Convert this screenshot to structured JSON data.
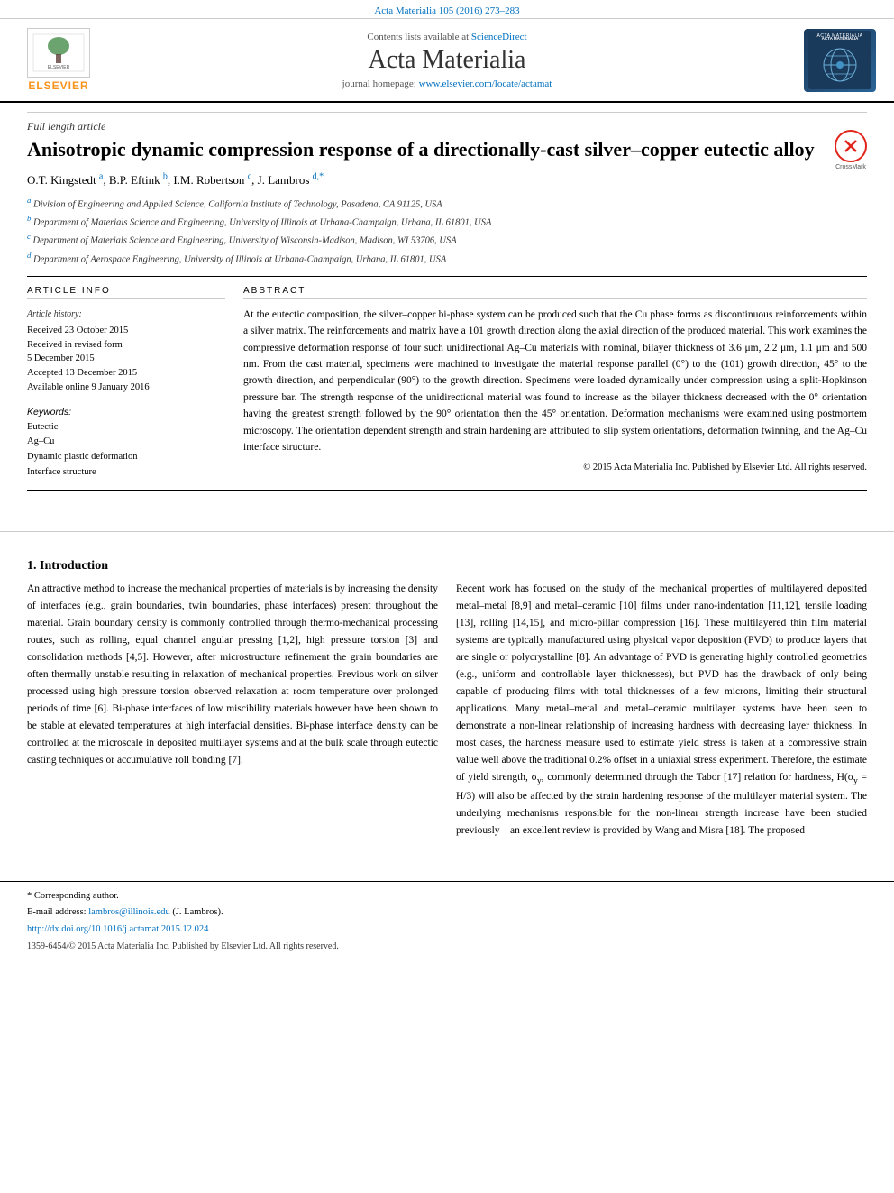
{
  "topbar": {
    "citation": "Acta Materialia 105 (2016) 273–283"
  },
  "header": {
    "contents_text": "Contents lists available at",
    "contents_link": "ScienceDirect",
    "journal_title": "Acta Materialia",
    "homepage_text": "journal homepage:",
    "homepage_url": "www.elsevier.com/locate/actamat",
    "elsevier_brand": "ELSEVIER"
  },
  "article": {
    "type": "Full length article",
    "title": "Anisotropic dynamic compression response of a directionally-cast silver–copper eutectic alloy",
    "authors": "O.T. Kingstedt a, B.P. Eftink b, I.M. Robertson c, J. Lambros d,*",
    "affiliations": [
      "a Division of Engineering and Applied Science, California Institute of Technology, Pasadena, CA 91125, USA",
      "b Department of Materials Science and Engineering, University of Illinois at Urbana-Champaign, Urbana, IL 61801, USA",
      "c Department of Materials Science and Engineering, University of Wisconsin-Madison, Madison, WI 53706, USA",
      "d Department of Aerospace Engineering, University of Illinois at Urbana-Champaign, Urbana, IL 61801, USA"
    ]
  },
  "article_info": {
    "section_label": "ARTICLE INFO",
    "history_label": "Article history:",
    "history_items": [
      "Received 23 October 2015",
      "Received in revised form",
      "5 December 2015",
      "Accepted 13 December 2015",
      "Available online 9 January 2016"
    ],
    "keywords_label": "Keywords:",
    "keywords": [
      "Eutectic",
      "Ag–Cu",
      "Dynamic plastic deformation",
      "Interface structure"
    ]
  },
  "abstract": {
    "section_label": "ABSTRACT",
    "text": "At the eutectic composition, the silver–copper bi-phase system can be produced such that the Cu phase forms as discontinuous reinforcements within a silver matrix. The reinforcements and matrix have a 101 growth direction along the axial direction of the produced material. This work examines the compressive deformation response of four such unidirectional Ag–Cu materials with nominal, bilayer thickness of 3.6 μm, 2.2 μm, 1.1 μm and 500 nm. From the cast material, specimens were machined to investigate the material response parallel (0°) to the (101) growth direction, 45° to the growth direction, and perpendicular (90°) to the growth direction. Specimens were loaded dynamically under compression using a split-Hopkinson pressure bar. The strength response of the unidirectional material was found to increase as the bilayer thickness decreased with the 0° orientation having the greatest strength followed by the 90° orientation then the 45° orientation. Deformation mechanisms were examined using postmortem microscopy. The orientation dependent strength and strain hardening are attributed to slip system orientations, deformation twinning, and the Ag–Cu interface structure.",
    "copyright": "© 2015 Acta Materialia Inc. Published by Elsevier Ltd. All rights reserved."
  },
  "introduction": {
    "section_number": "1.",
    "section_title": "Introduction",
    "left_col_paragraphs": [
      "An attractive method to increase the mechanical properties of materials is by increasing the density of interfaces (e.g., grain boundaries, twin boundaries, phase interfaces) present throughout the material. Grain boundary density is commonly controlled through thermo-mechanical processing routes, such as rolling, equal channel angular pressing [1,2], high pressure torsion [3] and consolidation methods [4,5]. However, after microstructure refinement the grain boundaries are often thermally unstable resulting in relaxation of mechanical properties. Previous work on silver processed using high pressure torsion observed relaxation at room temperature over prolonged periods of time [6]. Bi-phase interfaces of low miscibility materials however have been shown to be stable at elevated temperatures at high interfacial densities. Bi-phase interface density can be controlled at the microscale in deposited multilayer systems and at the bulk scale through eutectic casting techniques or accumulative roll bonding [7]."
    ],
    "right_col_paragraphs": [
      "Recent work has focused on the study of the mechanical properties of multilayered deposited metal–metal [8,9] and metal–ceramic [10] films under nano-indentation [11,12], tensile loading [13], rolling [14,15], and micro-pillar compression [16]. These multilayered thin film material systems are typically manufactured using physical vapor deposition (PVD) to produce layers that are single or polycrystalline [8]. An advantage of PVD is generating highly controlled geometries (e.g., uniform and controllable layer thicknesses), but PVD has the drawback of only being capable of producing films with total thicknesses of a few microns, limiting their structural applications. Many metal–metal and metal–ceramic multilayer systems have been seen to demonstrate a non-linear relationship of increasing hardness with decreasing layer thickness. In most cases, the hardness measure used to estimate yield stress is taken at a compressive strain value well above the traditional 0.2% offset in a uniaxial stress experiment. Therefore, the estimate of yield strength, σy, commonly determined through the Tabor [17] relation for hardness, H(σy = H/3) will also be affected by the strain hardening response of the multilayer material system. The underlying mechanisms responsible for the non-linear strength increase have been studied previously – an excellent review is provided by Wang and Misra [18]. The proposed"
    ]
  },
  "footnotes": {
    "corresponding": "* Corresponding author.",
    "email_label": "E-mail address:",
    "email": "lambros@illinois.edu",
    "email_name": "(J. Lambros).",
    "doi_label": "http://dx.doi.org/10.1016/j.actamat.2015.12.024",
    "copyright_bottom": "1359-6454/© 2015 Acta Materialia Inc. Published by Elsevier Ltd. All rights reserved."
  },
  "colors": {
    "accent_blue": "#0070c0",
    "crossmark_red": "#e2231a",
    "elsevier_orange": "#f7941e"
  }
}
